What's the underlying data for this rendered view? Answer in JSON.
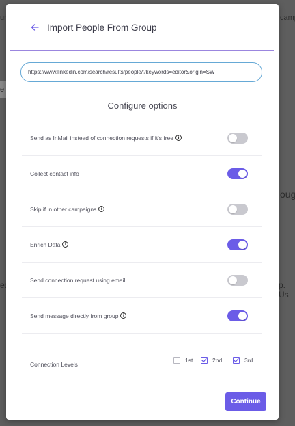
{
  "background": {
    "fragments": [
      "ur",
      "campa",
      "e",
      "ough",
      "ed",
      "p. Us"
    ]
  },
  "modal": {
    "title": "Import People From Group",
    "back_icon": "arrow-left-icon",
    "url_value": "https://www.linkedin.com/search/results/people/?keywords=editor&origin=SW",
    "section_title": "Configure options",
    "options": [
      {
        "label": "Send as InMail instead of connection requests if it's free",
        "info": true,
        "enabled": false
      },
      {
        "label": "Collect contact info",
        "info": false,
        "enabled": true
      },
      {
        "label": "Skip if in other campaigns",
        "info": true,
        "enabled": false
      },
      {
        "label": "Enrich Data",
        "info": true,
        "enabled": true
      },
      {
        "label": "Send connection request using email",
        "info": false,
        "enabled": false
      },
      {
        "label": "Send message directly from group",
        "info": true,
        "enabled": true
      }
    ],
    "info_icon_glyph": "i",
    "connection_levels": {
      "label": "Connection Levels",
      "levels": [
        {
          "label": "1st",
          "checked": false
        },
        {
          "label": "2nd",
          "checked": true
        },
        {
          "label": "3rd",
          "checked": true
        }
      ]
    },
    "continue_label": "Continue"
  },
  "colors": {
    "accent": "#6b5ce7",
    "toggle_off": "#c9c9cf",
    "input_border": "#66a9d6"
  }
}
